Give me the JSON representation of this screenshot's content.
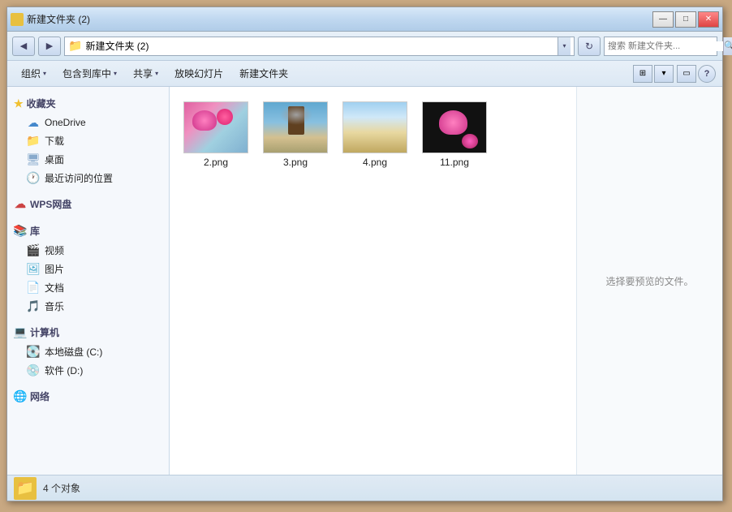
{
  "window": {
    "title": "新建文件夹 (2)",
    "controls": {
      "minimize": "—",
      "maximize": "□",
      "close": "✕"
    }
  },
  "address_bar": {
    "nav_back": "◀",
    "nav_forward": "▶",
    "path": "新建文件夹 (2)",
    "dropdown_arrow": "▾",
    "refresh": "↻",
    "search_placeholder": "搜索 新建文件夹...",
    "search_icon": "🔍"
  },
  "toolbar": {
    "organize": "组织",
    "organize_arrow": "▾",
    "include_library": "包含到库中",
    "include_library_arrow": "▾",
    "share": "共享",
    "share_arrow": "▾",
    "slideshow": "放映幻灯片",
    "new_folder": "新建文件夹",
    "view_icon": "⊞",
    "view_list": "≡",
    "help": "?"
  },
  "sidebar": {
    "favorites_label": "收藏夹",
    "items_favorites": [
      {
        "label": "OneDrive",
        "icon": "cloud"
      },
      {
        "label": "下载",
        "icon": "folder"
      },
      {
        "label": "桌面",
        "icon": "desktop"
      },
      {
        "label": "最近访问的位置",
        "icon": "recent"
      }
    ],
    "wps_label": "WPS网盘",
    "library_label": "库",
    "items_library": [
      {
        "label": "视频",
        "icon": "video"
      },
      {
        "label": "图片",
        "icon": "image"
      },
      {
        "label": "文档",
        "icon": "doc"
      },
      {
        "label": "音乐",
        "icon": "music"
      }
    ],
    "computer_label": "计算机",
    "items_computer": [
      {
        "label": "本地磁盘 (C:)",
        "icon": "hdd"
      },
      {
        "label": "软件 (D:)",
        "icon": "drive"
      }
    ],
    "network_label": "网络"
  },
  "files": [
    {
      "name": "2.png",
      "thumb": "2"
    },
    {
      "name": "3.png",
      "thumb": "3"
    },
    {
      "name": "4.png",
      "thumb": "4"
    },
    {
      "name": "11.png",
      "thumb": "11"
    }
  ],
  "preview": {
    "text": "选择要预览的文件。"
  },
  "status_bar": {
    "count_text": "4 个对象"
  }
}
